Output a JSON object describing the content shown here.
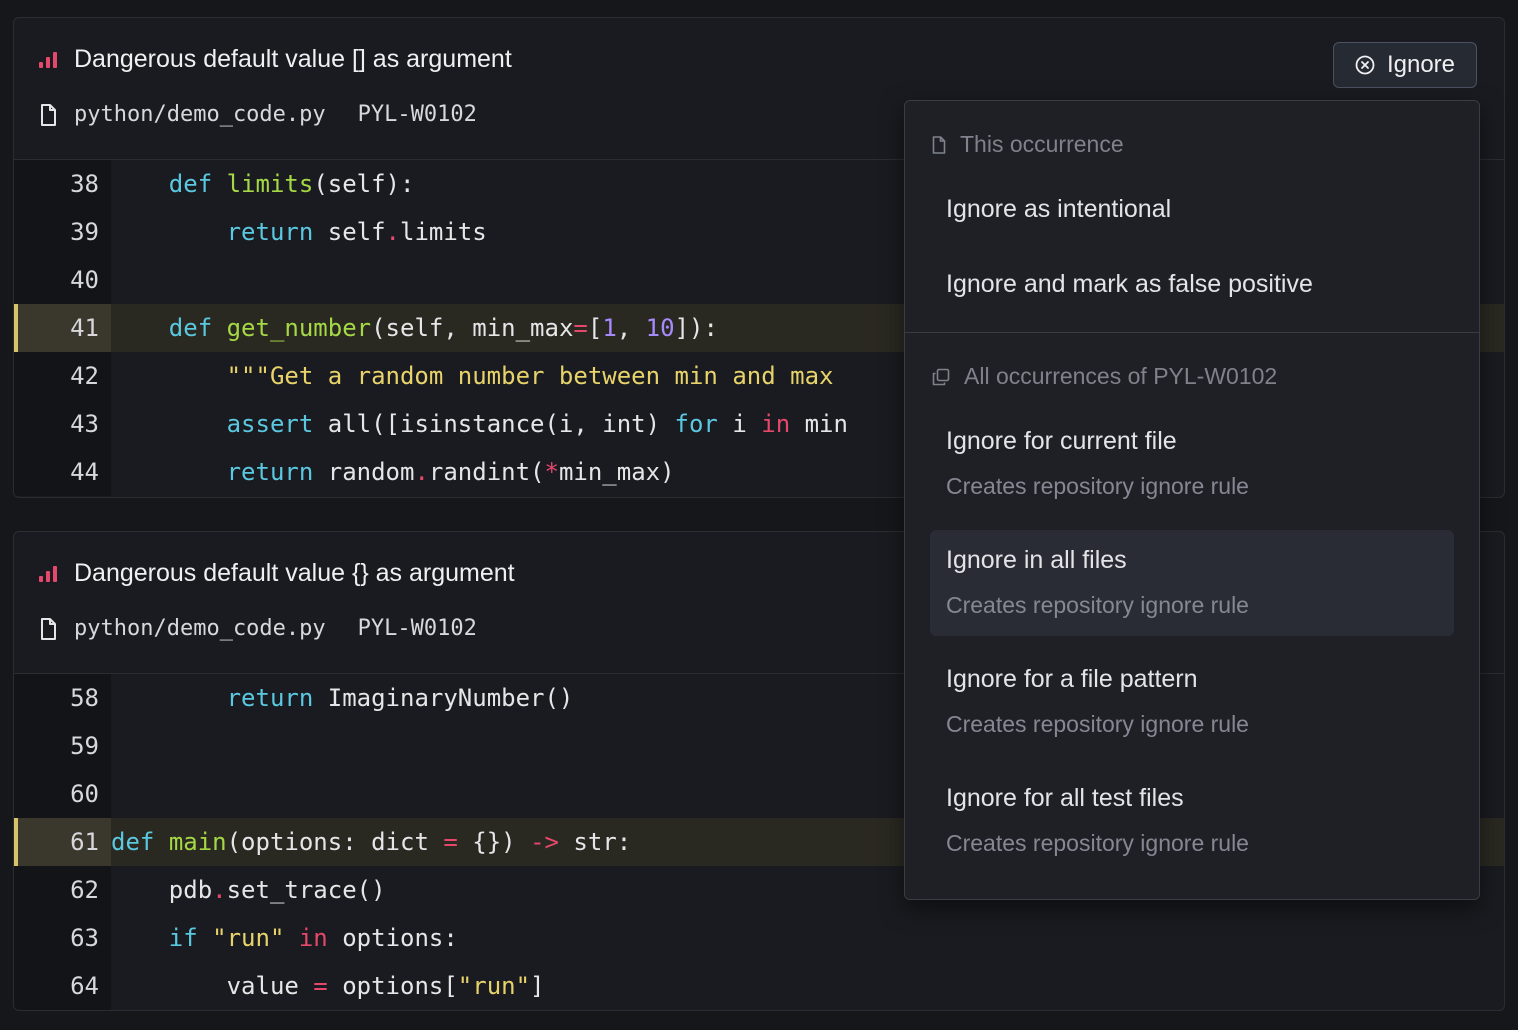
{
  "issues": [
    {
      "title": "Dangerous default value [] as argument",
      "file": "python/demo_code.py",
      "code": "PYL-W0102",
      "lines": [
        "38",
        "39",
        "40",
        "41",
        "42",
        "43",
        "44"
      ]
    },
    {
      "title": "Dangerous default value {} as argument",
      "file": "python/demo_code.py",
      "code": "PYL-W0102",
      "lines": [
        "58",
        "59",
        "60",
        "61",
        "62",
        "63",
        "64"
      ]
    }
  ],
  "ignore_button": {
    "label": "Ignore"
  },
  "dropdown": {
    "section1": {
      "title": "This occurrence"
    },
    "item1": {
      "label": "Ignore as intentional"
    },
    "item2": {
      "label": "Ignore and mark as false positive"
    },
    "section2": {
      "title": "All occurrences of PYL-W0102"
    },
    "item3": {
      "label": "Ignore for current file",
      "sub": "Creates repository ignore rule"
    },
    "item4": {
      "label": "Ignore in all files",
      "sub": "Creates repository ignore rule"
    },
    "item5": {
      "label": "Ignore for a file pattern",
      "sub": "Creates repository ignore rule"
    },
    "item6": {
      "label": "Ignore for all test files",
      "sub": "Creates repository ignore rule"
    }
  },
  "colors": {
    "severity": "#e5486b",
    "keyword": "#5ac8e0",
    "function": "#a5d845",
    "operator": "#e5486b",
    "number": "#a88aff",
    "string": "#e8d36b",
    "highlight_bar": "#d7c46a"
  }
}
